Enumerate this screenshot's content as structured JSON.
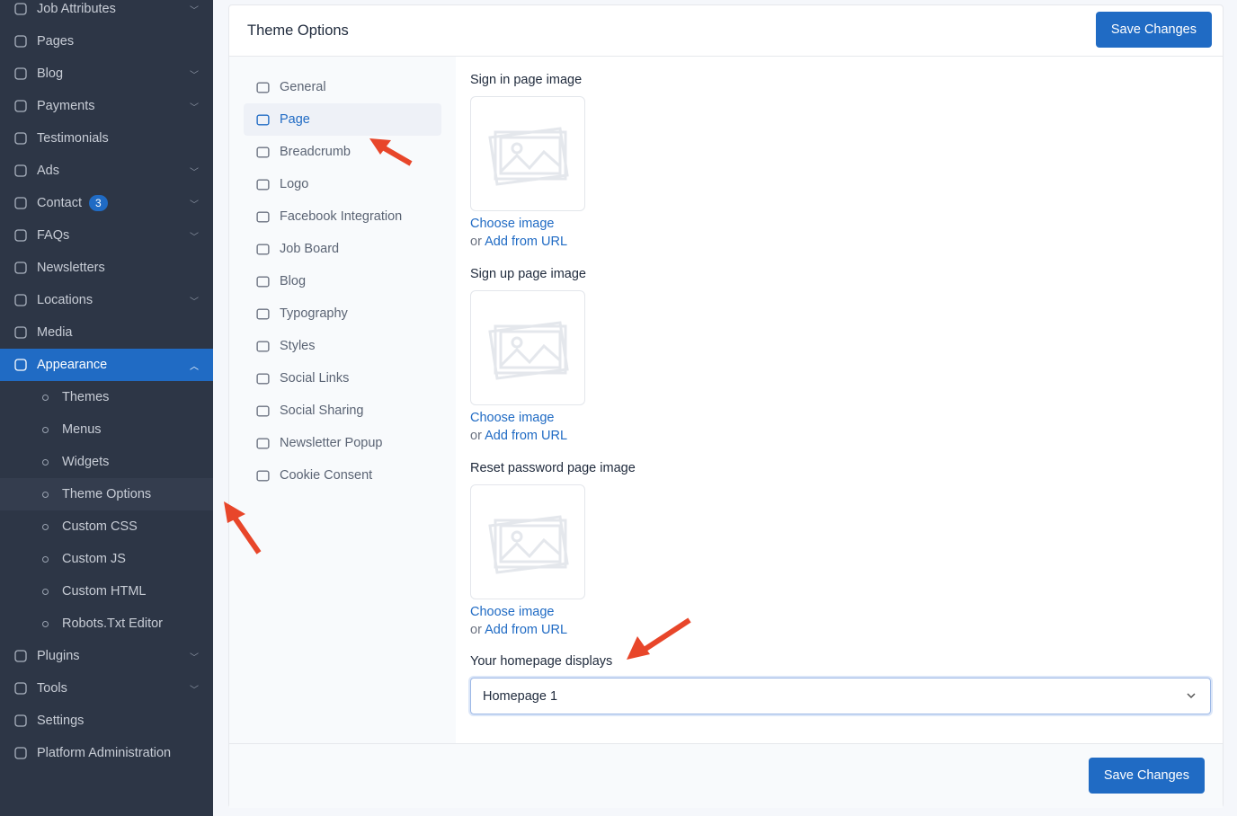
{
  "sidebar": {
    "items": [
      {
        "label": "Job Attributes",
        "icon": "tag-icon",
        "chevron": true
      },
      {
        "label": "Pages",
        "icon": "book-icon",
        "chevron": false
      },
      {
        "label": "Blog",
        "icon": "list-icon",
        "chevron": true
      },
      {
        "label": "Payments",
        "icon": "credit-card-icon",
        "chevron": true
      },
      {
        "label": "Testimonials",
        "icon": "user-star-icon",
        "chevron": false
      },
      {
        "label": "Ads",
        "icon": "ad-icon",
        "chevron": true
      },
      {
        "label": "Contact",
        "icon": "mail-icon",
        "chevron": true,
        "badge": "3"
      },
      {
        "label": "FAQs",
        "icon": "help-circle-icon",
        "chevron": true
      },
      {
        "label": "Newsletters",
        "icon": "mail-icon",
        "chevron": false
      },
      {
        "label": "Locations",
        "icon": "globe-icon",
        "chevron": true
      },
      {
        "label": "Media",
        "icon": "folder-icon",
        "chevron": false
      },
      {
        "label": "Appearance",
        "icon": "brush-icon",
        "chevron": true,
        "active": true
      }
    ],
    "subitems": [
      {
        "label": "Themes"
      },
      {
        "label": "Menus"
      },
      {
        "label": "Widgets"
      },
      {
        "label": "Theme Options",
        "current": true
      },
      {
        "label": "Custom CSS"
      },
      {
        "label": "Custom JS"
      },
      {
        "label": "Custom HTML"
      },
      {
        "label": "Robots.Txt Editor"
      }
    ],
    "bottom": [
      {
        "label": "Plugins",
        "icon": "plug-icon",
        "chevron": true
      },
      {
        "label": "Tools",
        "icon": "tool-icon",
        "chevron": true
      },
      {
        "label": "Settings",
        "icon": "gear-icon",
        "chevron": false
      },
      {
        "label": "Platform Administration",
        "icon": "user-cog-icon",
        "chevron": false
      }
    ]
  },
  "card": {
    "title": "Theme Options",
    "save_label": "Save Changes"
  },
  "nav": [
    {
      "label": "General",
      "icon": "home-icon"
    },
    {
      "label": "Page",
      "icon": "book-open-icon",
      "active": true
    },
    {
      "label": "Breadcrumb",
      "icon": "signpost-icon"
    },
    {
      "label": "Logo",
      "icon": "image-icon"
    },
    {
      "label": "Facebook Integration",
      "icon": "facebook-icon"
    },
    {
      "label": "Job Board",
      "icon": "briefcase-icon"
    },
    {
      "label": "Blog",
      "icon": "edit-icon"
    },
    {
      "label": "Typography",
      "icon": "typography-icon"
    },
    {
      "label": "Styles",
      "icon": "palette-icon"
    },
    {
      "label": "Social Links",
      "icon": "network-icon"
    },
    {
      "label": "Social Sharing",
      "icon": "share-icon"
    },
    {
      "label": "Newsletter Popup",
      "icon": "mail-open-icon"
    },
    {
      "label": "Cookie Consent",
      "icon": "cookie-icon"
    }
  ],
  "fields": [
    {
      "label": "Sign in page image",
      "choose": "Choose image",
      "or": "or",
      "add_url": "Add from URL"
    },
    {
      "label": "Sign up page image",
      "choose": "Choose image",
      "or": "or",
      "add_url": "Add from URL"
    },
    {
      "label": "Reset password page image",
      "choose": "Choose image",
      "or": "or",
      "add_url": "Add from URL"
    }
  ],
  "homepage": {
    "label": "Your homepage displays",
    "value": "Homepage 1"
  },
  "colors": {
    "accent": "#206bc4",
    "sidebar": "#2d3646",
    "annotation_arrow": "#e8462a"
  }
}
